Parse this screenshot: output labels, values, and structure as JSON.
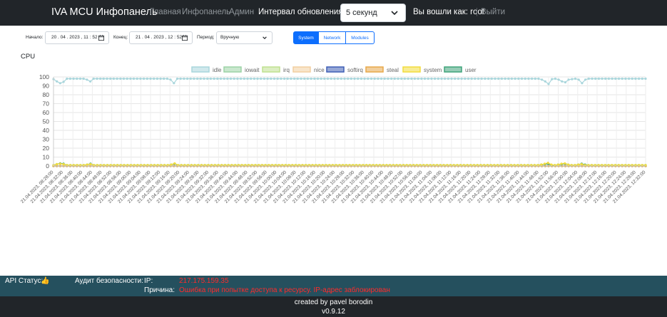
{
  "navbar": {
    "brand": "IVA MCU Инфопанель",
    "links": [
      "Главная",
      "Инфопанель",
      "Админ"
    ],
    "interval_label": "Интервал обновления:",
    "interval_value": "5 секунд",
    "logged_in_text": "Вы вошли как: root",
    "logout": "Выйти"
  },
  "filters": {
    "start_label": "Начало:",
    "start_value": "20 . 04 . 2023 ,  11 : 52",
    "end_label": "Конец:",
    "end_value": "21 . 04 . 2023 ,  12 : 52",
    "period_label": "Период:",
    "period_value": "Вручную",
    "tabs": [
      "System",
      "Network",
      "Modules"
    ],
    "active_tab": "System"
  },
  "chart_title": "CPU",
  "colors": {
    "idle": "#a9d6dc",
    "iowait": "#9cd3a6",
    "irq": "#bfe08f",
    "nice": "#f2cfa0",
    "softirq": "#3f5fb5",
    "steal": "#e8a84a",
    "system": "#f2dc3c",
    "user": "#3fa37a"
  },
  "chart_data": {
    "type": "line",
    "legend": [
      "idle",
      "iowait",
      "irq",
      "nice",
      "softirq",
      "steal",
      "system",
      "user"
    ],
    "ylim": [
      0,
      100
    ],
    "yticks": [
      0,
      10,
      20,
      30,
      40,
      50,
      60,
      70,
      80,
      90,
      100
    ],
    "x_labels": [
      "21.04.2023, 08:28:00",
      "21.04.2023, 08:32:00",
      "21.04.2023, 08:36:00",
      "21.04.2023, 08:40:00",
      "21.04.2023, 08:44:00",
      "21.04.2023, 08:48:00",
      "21.04.2023, 08:52:00",
      "21.04.2023, 08:56:00",
      "21.04.2023, 09:00:00",
      "21.04.2023, 09:04:00",
      "21.04.2023, 09:08:00",
      "21.04.2023, 09:12:00",
      "21.04.2023, 09:16:00",
      "21.04.2023, 09:20:00",
      "21.04.2023, 09:24:00",
      "21.04.2023, 09:28:00",
      "21.04.2023, 09:32:00",
      "21.04.2023, 09:36:00",
      "21.04.2023, 09:40:00",
      "21.04.2023, 09:44:00",
      "21.04.2023, 09:48:00",
      "21.04.2023, 09:52:00",
      "21.04.2023, 09:56:00",
      "21.04.2023, 10:00:00",
      "21.04.2023, 10:04:00",
      "21.04.2023, 10:08:00",
      "21.04.2023, 10:12:00",
      "21.04.2023, 10:16:00",
      "21.04.2023, 10:20:00",
      "21.04.2023, 10:24:00",
      "21.04.2023, 10:28:00",
      "21.04.2023, 10:32:00",
      "21.04.2023, 10:36:00",
      "21.04.2023, 10:40:00",
      "21.04.2023, 10:44:00",
      "21.04.2023, 10:48:00",
      "21.04.2023, 10:52:00",
      "21.04.2023, 10:56:00",
      "21.04.2023, 11:00:00",
      "21.04.2023, 11:04:00",
      "21.04.2023, 11:08:00",
      "21.04.2023, 11:12:00",
      "21.04.2023, 11:16:00",
      "21.04.2023, 11:20:00",
      "21.04.2023, 11:24:00",
      "21.04.2023, 11:28:00",
      "21.04.2023, 11:32:00",
      "21.04.2023, 11:36:00",
      "21.04.2023, 11:40:00",
      "21.04.2023, 11:44:00",
      "21.04.2023, 11:48:00",
      "21.04.2023, 11:52:00",
      "21.04.2023, 11:56:00",
      "21.04.2023, 12:00:00",
      "21.04.2023, 12:04:00",
      "21.04.2023, 12:08:00",
      "21.04.2023, 12:12:00",
      "21.04.2023, 12:16:00",
      "21.04.2023, 12:20:00",
      "21.04.2023, 12:24:00",
      "21.04.2023, 12:28:00",
      "21.04.2023, 12:32:00"
    ],
    "idle": [
      97.5,
      95,
      93,
      94.5,
      98,
      98,
      98,
      98,
      98,
      98,
      97,
      95,
      98,
      98,
      98,
      98,
      98,
      98,
      98,
      98,
      98,
      98,
      98,
      98,
      98,
      98,
      98,
      98,
      98,
      98,
      98,
      98,
      98,
      98,
      98,
      97,
      93,
      98,
      98,
      98,
      98,
      98,
      98,
      98,
      98,
      98,
      98,
      98,
      98,
      98,
      98,
      98,
      98,
      98,
      98,
      98,
      98,
      98,
      98,
      98,
      98,
      98,
      98,
      98,
      98,
      98,
      98,
      98,
      98,
      98,
      98,
      98,
      98,
      98,
      98,
      98,
      98,
      98,
      98,
      98,
      98,
      98,
      98,
      98,
      98,
      98,
      98,
      98,
      98,
      98,
      98,
      98,
      98,
      98,
      98,
      98,
      98,
      98,
      98,
      98,
      98,
      98,
      98,
      98,
      98,
      98,
      98,
      98,
      98,
      98,
      98,
      98,
      98,
      98,
      98,
      98,
      98,
      98,
      98,
      98,
      98,
      98,
      98,
      98,
      98,
      98,
      98,
      98,
      98,
      98,
      98,
      98,
      98,
      98,
      98,
      98,
      98,
      98,
      98,
      98,
      98,
      98,
      98,
      98,
      98,
      98,
      97,
      95,
      92,
      97.5,
      98,
      97,
      95,
      94,
      97,
      97.5,
      98,
      97,
      93,
      97,
      98,
      98,
      98,
      98,
      98,
      98,
      98,
      98,
      98,
      98,
      98,
      98,
      98,
      98,
      98,
      98,
      98,
      98
    ],
    "system": [
      1,
      2,
      2.5,
      2,
      1,
      1,
      1,
      1,
      1,
      1,
      1.5,
      2,
      1,
      1,
      1,
      1,
      1,
      1,
      1,
      1,
      1,
      1,
      1,
      1,
      1,
      1,
      1,
      1,
      1,
      1,
      1,
      1,
      1,
      1,
      1,
      1.5,
      3,
      1,
      1,
      1,
      1,
      1,
      1,
      1,
      1,
      1,
      1,
      1,
      1,
      1,
      1,
      1,
      1,
      1,
      1,
      1,
      1,
      1,
      1,
      1,
      1,
      1,
      1,
      1,
      1,
      1,
      1,
      1,
      1,
      1,
      1,
      1,
      1,
      1,
      1,
      1,
      1,
      1,
      1,
      1,
      1,
      1,
      1,
      1,
      1,
      1,
      1,
      1,
      1,
      1,
      1,
      1,
      1,
      1,
      1,
      1,
      1,
      1,
      1,
      1,
      1,
      1,
      1,
      1,
      1,
      1,
      1,
      1,
      1,
      1,
      1,
      1,
      1,
      1,
      1,
      1,
      1,
      1,
      1,
      1,
      1,
      1,
      1,
      1,
      1,
      1,
      1,
      1,
      1,
      1,
      1,
      1,
      1,
      1,
      1,
      1,
      1,
      1,
      1,
      1,
      1,
      1,
      1,
      1,
      1,
      1.5,
      2.5,
      3.5,
      1.5,
      1,
      1.5,
      2.5,
      3,
      1.5,
      1,
      1,
      1.5,
      2,
      1,
      1,
      1,
      1,
      1,
      1,
      1,
      1,
      1,
      1,
      1,
      1,
      1,
      1,
      1,
      1,
      1,
      1,
      1
    ],
    "user": [
      1,
      2,
      3,
      2.5,
      1,
      1,
      1,
      1,
      1,
      1,
      1.5,
      2.5,
      1,
      1,
      1,
      1,
      1,
      1,
      1,
      1,
      1,
      1,
      1,
      1,
      1,
      1,
      1,
      1,
      1,
      1,
      1,
      1,
      1,
      1,
      1,
      1.5,
      2.5,
      1,
      1,
      1,
      1,
      1,
      1,
      1,
      1,
      1,
      1,
      1,
      1,
      1,
      1,
      1,
      1,
      1,
      1,
      1,
      1,
      1,
      1,
      1,
      1,
      1,
      1,
      1,
      1,
      1,
      1,
      1,
      1,
      1,
      1,
      1,
      1,
      1,
      1,
      1,
      1,
      1,
      1,
      1,
      1,
      1,
      1,
      1,
      1,
      1,
      1,
      1,
      1,
      1,
      1,
      1,
      1,
      1,
      1,
      1,
      1,
      1,
      1,
      1,
      1,
      1,
      1,
      1,
      1,
      1,
      1,
      1,
      1,
      1,
      1,
      1,
      1,
      1,
      1,
      1,
      1,
      1,
      1,
      1,
      1,
      1,
      1,
      1,
      1,
      1,
      1,
      1,
      1,
      1,
      1,
      1,
      1,
      1,
      1,
      1,
      1,
      1,
      1,
      1,
      1,
      1,
      1,
      1,
      1,
      1.5,
      2,
      2.5,
      1,
      1,
      1.5,
      2,
      2.5,
      1.5,
      1,
      1,
      1.5,
      2.5,
      1.5,
      1,
      1,
      1,
      1,
      1,
      1,
      1,
      1,
      1,
      1,
      1,
      1,
      1,
      1,
      1,
      1,
      1,
      1
    ],
    "zero_series": [
      "iowait",
      "irq",
      "nice",
      "softirq",
      "steal"
    ],
    "title": "CPU",
    "xlabel": "",
    "ylabel": ""
  },
  "status_bar": {
    "api_label": "API Статус:",
    "api_icon": "👍",
    "audit_label": "Аудит безопасности:",
    "ip_label": "IP:",
    "ip_value": "217.175.159.35",
    "reason_label": "Причина:",
    "reason_value": "Ошибка при попытке доступа к ресурсу. IP-адрес заблокирован"
  },
  "footer": {
    "created_by": "created by pavel borodin",
    "version": "v0.9.12"
  }
}
